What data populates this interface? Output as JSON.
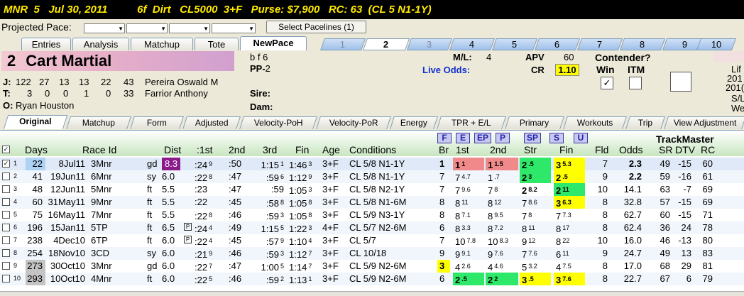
{
  "header": {
    "text": "MNR  5   Jul 30, 2011          6f  Dirt   CL5000  3+F   Purse: $7,900   RC: 63  (CL 5 N1-1Y)"
  },
  "pace": {
    "label": "Projected Pace:",
    "button": "Select Pacelines  (1)"
  },
  "tabs": [
    "Entries",
    "Analysis",
    "Matchup",
    "Tote",
    "NewPace"
  ],
  "horse_tabs": [
    "1",
    "2",
    "3",
    "4",
    "5",
    "6",
    "7",
    "8",
    "9",
    "10"
  ],
  "horse": {
    "number": "2",
    "name": "Cart Martial",
    "sex": "b f 6",
    "pp_label": "PP-",
    "pp": "2",
    "j_label": "J:",
    "j_stats": [
      "122",
      "27",
      "13",
      "13",
      "22",
      "43"
    ],
    "jockey": "Pereira Oswald M",
    "t_label": "T:",
    "t_stats": [
      "3",
      "0",
      "0",
      "1",
      "0",
      "33"
    ],
    "trainer": "Farrior Anthony",
    "o_label": "O:",
    "owner": "Ryan Houston",
    "sire_label": "Sire:",
    "dam_label": "Dam:",
    "ml_label": "M/L:",
    "ml": "4",
    "apv_label": "APV",
    "apv": "60",
    "live_odds_label": "Live Odds:",
    "cr_label": "CR",
    "cr": "1.10",
    "contender_label": "Contender?",
    "win_label": "Win",
    "itm_label": "ITM",
    "win_check": "✓",
    "side": [
      "Lif",
      "201",
      "201(",
      "S/L",
      "We"
    ]
  },
  "view_tabs": [
    "Original",
    "Matchup",
    "Form",
    "Adjusted",
    "Velocity-PoH",
    "Velocity-PoR",
    "Energy",
    "TPR + E/L",
    "Primary",
    "Workouts",
    "Trip",
    "View Adjustment"
  ],
  "filter_buttons": [
    "F",
    "E",
    "EP",
    "P",
    "SP",
    "S",
    "U"
  ],
  "trackmaster": "TrackMaster",
  "columns": [
    "Days",
    "Race Id",
    "Dist",
    ":1st",
    "2nd",
    "3rd",
    "Fin",
    "Age",
    "Conditions",
    "Br",
    "1st",
    "2nd",
    "Str",
    "Fin",
    "Fld",
    "Odds",
    "SR",
    "DTV",
    "RC"
  ],
  "rows": [
    {
      "n": "1",
      "days": "22",
      "date": "8Jul11",
      "race": "3Mnr",
      "cond": "gd",
      "dist": "8.3",
      "q1": ":24",
      "q1s": "9",
      "q2": ":50",
      "q3": "1:15",
      "q3s": "1",
      "fin": "1:46",
      "fins": "3",
      "age": "3+F",
      "conds": "CL 5/8 N1-1Y",
      "br": "1",
      "p1": "1",
      "p1s": "1",
      "p2": "1",
      "p2s": "1.5",
      "st": "2",
      "sts": ".5",
      "f": "3",
      "fs": "5.3",
      "fld": "7",
      "odds": "2.3",
      "sr": "49",
      "dtv": "-15",
      "rc": "60"
    },
    {
      "n": "2",
      "days": "41",
      "date": "19Jun11",
      "race": "6Mnr",
      "cond": "sy",
      "dist": "6.0",
      "q1": ":22",
      "q1s": "8",
      "q2": ":47",
      "q3": ":59",
      "q3s": "6",
      "fin": "1:12",
      "fins": "9",
      "age": "3+F",
      "conds": "CL 5/8 N1-1Y",
      "br": "7",
      "p1": "7",
      "p1s": "4.7",
      "p2": "1",
      "p2s": ".7",
      "st": "2",
      "sts": "3",
      "f": "2",
      "fs": ".5",
      "fld": "9",
      "odds": "2.2",
      "sr": "59",
      "dtv": "-16",
      "rc": "61"
    },
    {
      "n": "3",
      "days": "48",
      "date": "12Jun11",
      "race": "5Mnr",
      "cond": "ft",
      "dist": "5.5",
      "q1": ":23",
      "q1s": "",
      "q2": ":47",
      "q3": ":59",
      "q3s": "",
      "fin": "1:05",
      "fins": "3",
      "age": "3+F",
      "conds": "CL 5/8 N2-1Y",
      "br": "7",
      "p1": "7",
      "p1s": "9.6",
      "p2": "7",
      "p2s": "8",
      "st": "2",
      "sts": "8.2",
      "f": "2",
      "fs": "11",
      "fld": "10",
      "odds": "14.1",
      "sr": "63",
      "dtv": "-7",
      "rc": "69"
    },
    {
      "n": "4",
      "days": "60",
      "date": "31May11",
      "race": "9Mnr",
      "cond": "ft",
      "dist": "5.5",
      "q1": ":22",
      "q1s": "",
      "q2": ":45",
      "q3": ":58",
      "q3s": "8",
      "fin": "1:05",
      "fins": "8",
      "age": "3+F",
      "conds": "CL 5/8 N1-6M",
      "br": "8",
      "p1": "8",
      "p1s": "11",
      "p2": "8",
      "p2s": "12",
      "st": "7",
      "sts": "8.6",
      "f": "3",
      "fs": "6.3",
      "fld": "8",
      "odds": "32.8",
      "sr": "57",
      "dtv": "-15",
      "rc": "69"
    },
    {
      "n": "5",
      "days": "75",
      "date": "16May11",
      "race": "7Mnr",
      "cond": "ft",
      "dist": "5.5",
      "q1": ":22",
      "q1s": "8",
      "q2": ":46",
      "q3": ":59",
      "q3s": "3",
      "fin": "1:05",
      "fins": "8",
      "age": "3+F",
      "conds": "CL 5/9 N3-1Y",
      "br": "8",
      "p1": "8",
      "p1s": "7.1",
      "p2": "8",
      "p2s": "9.5",
      "st": "7",
      "sts": "8",
      "f": "7",
      "fs": "7.3",
      "fld": "8",
      "odds": "62.7",
      "sr": "60",
      "dtv": "-15",
      "rc": "71"
    },
    {
      "n": "6",
      "days": "196",
      "date": "15Jan11",
      "race": "5TP",
      "cond": "ft",
      "dist": "6.5",
      "q1": ":24",
      "q1s": "4",
      "q2": ":49",
      "q3": "1:15",
      "q3s": "5",
      "fin": "1:22",
      "fins": "3",
      "age": "4+F",
      "conds": "CL 5/7 N2-6M",
      "br": "6",
      "p1": "8",
      "p1s": "3.3",
      "p2": "8",
      "p2s": "7.2",
      "st": "8",
      "sts": "11",
      "f": "8",
      "fs": "17",
      "fld": "8",
      "odds": "62.4",
      "sr": "36",
      "dtv": "24",
      "rc": "78"
    },
    {
      "n": "7",
      "days": "238",
      "date": "4Dec10",
      "race": "6TP",
      "cond": "ft",
      "dist": "6.0",
      "q1": ":22",
      "q1s": "4",
      "q2": ":45",
      "q3": ":57",
      "q3s": "9",
      "fin": "1:10",
      "fins": "4",
      "age": "3+F",
      "conds": "CL 5/7",
      "br": "7",
      "p1": "10",
      "p1s": "7.8",
      "p2": "10",
      "p2s": "8.3",
      "st": "9",
      "sts": "12",
      "f": "8",
      "fs": "22",
      "fld": "10",
      "odds": "16.0",
      "sr": "46",
      "dtv": "-13",
      "rc": "80"
    },
    {
      "n": "8",
      "days": "254",
      "date": "18Nov10",
      "race": "3CD",
      "cond": "sy",
      "dist": "6.0",
      "q1": ":21",
      "q1s": "9",
      "q2": ":46",
      "q3": ":59",
      "q3s": "3",
      "fin": "1:12",
      "fins": "7",
      "age": "3+F",
      "conds": "CL 10/18",
      "br": "9",
      "p1": "9",
      "p1s": "9.1",
      "p2": "9",
      "p2s": "7.6",
      "st": "7",
      "sts": "7.6",
      "f": "6",
      "fs": "11",
      "fld": "9",
      "odds": "24.7",
      "sr": "49",
      "dtv": "13",
      "rc": "83"
    },
    {
      "n": "9",
      "days": "273",
      "date": "30Oct10",
      "race": "3Mnr",
      "cond": "gd",
      "dist": "6.0",
      "q1": ":22",
      "q1s": "7",
      "q2": ":47",
      "q3": "1:00",
      "q3s": "5",
      "fin": "1:14",
      "fins": "7",
      "age": "3+F",
      "conds": "CL 5/9 N2-6M",
      "br": "3",
      "p1": "4",
      "p1s": "2.6",
      "p2": "4",
      "p2s": "4.6",
      "st": "5",
      "sts": "3.2",
      "f": "4",
      "fs": "7.5",
      "fld": "8",
      "odds": "17.0",
      "sr": "68",
      "dtv": "29",
      "rc": "81"
    },
    {
      "n": "10",
      "days": "293",
      "date": "10Oct10",
      "race": "4Mnr",
      "cond": "ft",
      "dist": "6.0",
      "q1": ":22",
      "q1s": "5",
      "q2": ":46",
      "q3": ":59",
      "q3s": "2",
      "fin": "1:13",
      "fins": "1",
      "age": "3+F",
      "conds": "CL 5/9 N2-6M",
      "br": "6",
      "p1": "2",
      "p1s": ".5",
      "p2": "2",
      "p2s": "2",
      "st": "3",
      "sts": ".5",
      "f": "3",
      "fs": "7.6",
      "fld": "8",
      "odds": "22.7",
      "sr": "67",
      "dtv": "6",
      "rc": "79"
    }
  ],
  "colors": {
    "red": "#f08a8a",
    "green": "#2ee86a",
    "yellow": "#ffff00",
    "purple": "#8b1a8b"
  }
}
